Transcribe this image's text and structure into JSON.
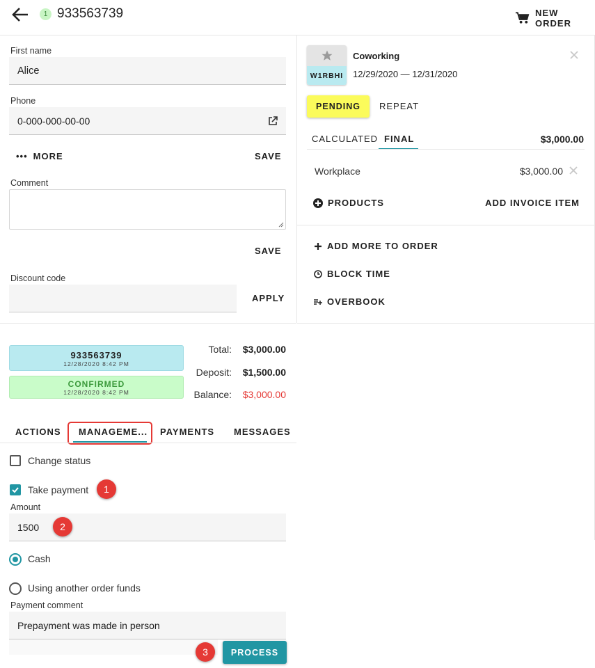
{
  "header": {
    "step_badge": "1",
    "order_number": "933563739",
    "new_order_label": "NEW ORDER"
  },
  "customer": {
    "first_name_label": "First name",
    "first_name_value": "Alice",
    "phone_label": "Phone",
    "phone_value": "0-000-000-00-00",
    "more_label": "MORE",
    "save_label": "SAVE",
    "comment_label": "Comment",
    "comment_save_label": "SAVE",
    "discount_label": "Discount code",
    "apply_label": "APPLY"
  },
  "summary": {
    "order_id": "933563739",
    "order_date": "12/28/2020 8:42 PM",
    "status": "CONFIRMED",
    "status_date": "12/28/2020 8:42 PM",
    "total_label": "Total:",
    "total_value": "$3,000.00",
    "deposit_label": "Deposit:",
    "deposit_value": "$1,500.00",
    "balance_label": "Balance:",
    "balance_value": "$3,000.00"
  },
  "tabs": {
    "actions": "ACTIONS",
    "management": "MANAGEME...",
    "payments": "PAYMENTS",
    "messages": "MESSAGES"
  },
  "management": {
    "change_status_label": "Change status",
    "take_payment_label": "Take payment",
    "amount_label": "Amount",
    "amount_value": "1500",
    "cash_label": "Cash",
    "other_funds_label": "Using another order funds",
    "payment_comment_label": "Payment comment",
    "payment_comment_value": "Prepayment was made in person",
    "process_label": "PROCESS"
  },
  "annotations": [
    "1",
    "2",
    "3"
  ],
  "booking": {
    "resource_name": "Coworking",
    "resource_code": "W1RBHI",
    "date_range": "12/29/2020 — 12/31/2020",
    "status_label": "PENDING",
    "repeat_label": "REPEAT",
    "tab_calculated": "CALCULATED",
    "tab_final": "FINAL",
    "total_value": "$3,000.00",
    "item_name": "Workplace",
    "item_price": "$3,000.00",
    "products_label": "PRODUCTS",
    "add_invoice_label": "ADD INVOICE ITEM",
    "add_more_label": "ADD MORE TO ORDER",
    "block_time_label": "BLOCK TIME",
    "overbook_label": "OVERBOOK"
  },
  "colors": {
    "accent": "#2196a3",
    "pending_bg": "#fbfb5b",
    "order_id_bg": "#b9eaf0",
    "confirmed_bg": "#c9fcc9",
    "confirmed_text": "#3c9a3c",
    "balance_red": "#e53935",
    "annotation_red": "#e53935"
  }
}
